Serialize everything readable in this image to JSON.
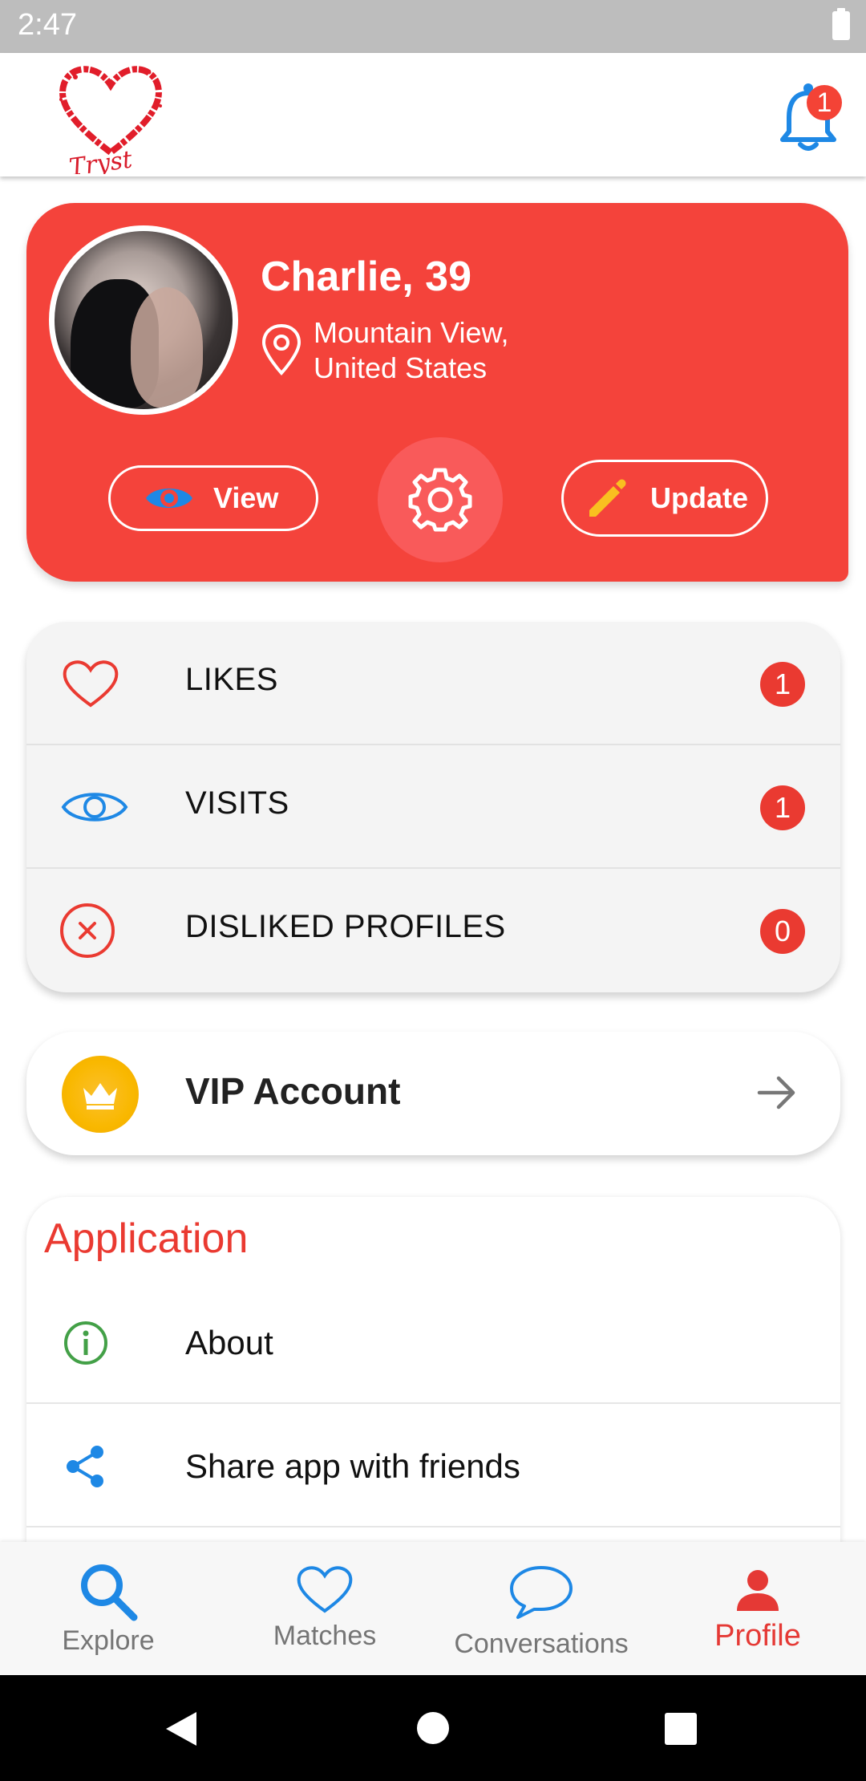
{
  "status_bar": {
    "time": "2:47"
  },
  "app_bar": {
    "logo_text": "Tryst",
    "notification_count": "1"
  },
  "profile": {
    "name": "Charlie, 39",
    "location_line1": "Mountain View,",
    "location_line2": "United States",
    "view_label": "View",
    "update_label": "Update"
  },
  "stats": [
    {
      "label": "LIKES",
      "count": "1",
      "icon": "heart-icon"
    },
    {
      "label": "VISITS",
      "count": "1",
      "icon": "eye-icon"
    },
    {
      "label": "DISLIKED PROFILES",
      "count": "0",
      "icon": "close-circle-icon"
    }
  ],
  "vip": {
    "label": "VIP Account",
    "icon": "crown-icon"
  },
  "application": {
    "header": "Application",
    "items": [
      {
        "label": "About",
        "icon": "info-icon"
      },
      {
        "label": "Share app with friends",
        "icon": "share-icon"
      }
    ]
  },
  "bottom_nav": [
    {
      "label": "Explore",
      "icon": "search-icon"
    },
    {
      "label": "Matches",
      "icon": "heart-icon"
    },
    {
      "label": "Conversations",
      "icon": "chat-icon"
    },
    {
      "label": "Profile",
      "icon": "person-icon",
      "active": true
    }
  ],
  "colors": {
    "accent_red": "#f4433b",
    "badge_red": "#ea3a31",
    "blue": "#1e88e5",
    "gold": "#f9b800",
    "green": "#43a047"
  }
}
